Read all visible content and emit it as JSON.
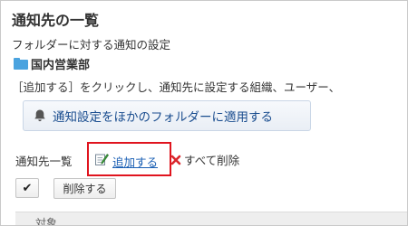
{
  "page": {
    "title": "通知先の一覧",
    "subtitle": "フォルダーに対する通知の設定"
  },
  "folder": {
    "icon": "folder-icon",
    "name": "国内営業部"
  },
  "instruction": "［追加する］をクリックし、通知先に設定する組織、ユーザー、",
  "apply_button": {
    "icon": "bell-icon",
    "label": "通知設定をほかのフォルダーに適用する"
  },
  "recipients": {
    "label": "通知先一覧",
    "add": {
      "icon": "add-edit-icon",
      "label": "追加する",
      "highlight_color": "#e0141e"
    },
    "delete_all": {
      "icon": "red-x-icon",
      "label": "すべて削除"
    },
    "select_all_checked": true,
    "delete_label": "削除する",
    "table_header": "対象"
  },
  "colors": {
    "folder": "#4aa3df",
    "link": "#1a5fb4",
    "button_text": "#1a4d8f",
    "highlight": "#e0141e",
    "delete_x": "#d9262c"
  }
}
